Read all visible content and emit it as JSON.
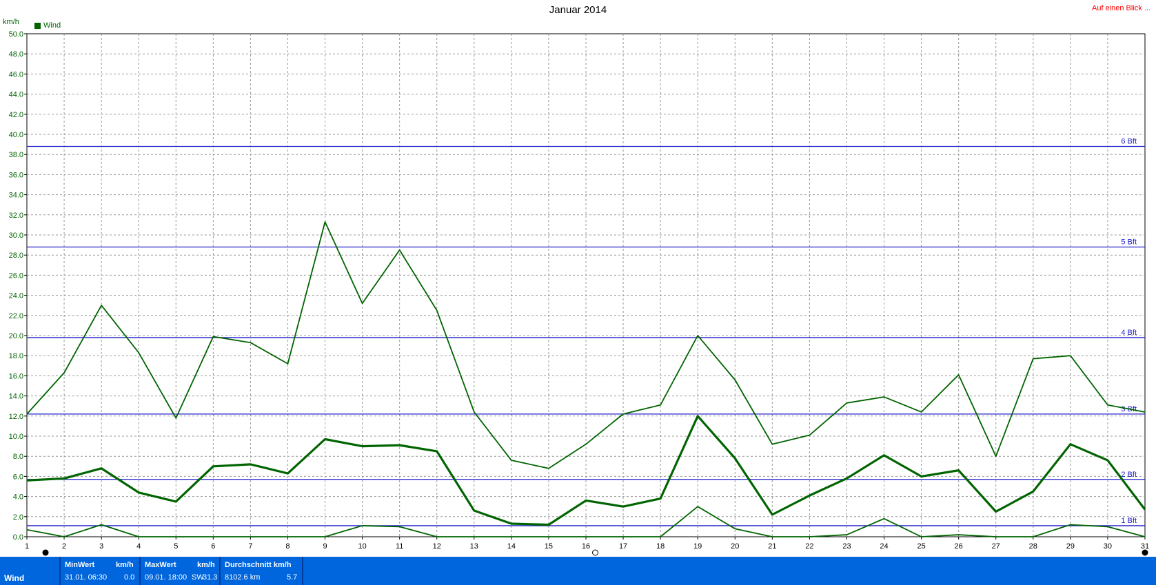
{
  "header": {
    "title": "Januar 2014",
    "link": "Auf einen Blick ...",
    "unit": "km/h",
    "legend_label": "Wind"
  },
  "colors": {
    "series": "#006400",
    "reference": "#2020cc",
    "footer_bg": "#0066dd",
    "link": "#ff0000"
  },
  "chart_data": {
    "type": "line",
    "title": "Januar 2014",
    "ylabel": "km/h",
    "xlim": [
      1,
      31
    ],
    "ylim": [
      0,
      50
    ],
    "ytick_step": 2,
    "grid": true,
    "legend": "top-left",
    "x": [
      1,
      2,
      3,
      4,
      5,
      6,
      7,
      8,
      9,
      10,
      11,
      12,
      13,
      14,
      15,
      16,
      17,
      18,
      19,
      20,
      21,
      22,
      23,
      24,
      25,
      26,
      27,
      28,
      29,
      30,
      31
    ],
    "series": [
      {
        "name": "Wind",
        "role": "max",
        "values": [
          12.2,
          16.3,
          23.0,
          18.3,
          11.8,
          19.9,
          19.3,
          17.2,
          31.3,
          23.2,
          28.5,
          22.5,
          12.4,
          7.6,
          6.8,
          9.2,
          12.2,
          13.1,
          20.0,
          15.6,
          9.2,
          10.1,
          13.3,
          13.9,
          12.4,
          16.1,
          8.0,
          17.7,
          18.0,
          13.1,
          12.4
        ]
      },
      {
        "role": "average",
        "values": [
          5.6,
          5.8,
          6.8,
          4.4,
          3.5,
          7.0,
          7.2,
          6.3,
          9.7,
          9.0,
          9.1,
          8.5,
          2.6,
          1.3,
          1.2,
          3.6,
          3.0,
          3.8,
          12.0,
          7.8,
          2.2,
          4.1,
          5.8,
          8.1,
          6.0,
          6.6,
          2.5,
          4.5,
          9.2,
          7.6,
          2.7
        ]
      },
      {
        "role": "min",
        "values": [
          0.7,
          0.0,
          1.2,
          0.0,
          0.0,
          0.0,
          0.0,
          0.0,
          0.0,
          1.1,
          1.0,
          0.0,
          0.0,
          0.0,
          0.0,
          0.0,
          0.0,
          0.0,
          3.0,
          0.8,
          0.0,
          0.0,
          0.2,
          1.8,
          0.0,
          0.2,
          0.0,
          0.0,
          1.2,
          1.0,
          0.0
        ]
      }
    ],
    "reference_lines": [
      {
        "label": "1 Bft",
        "value": 1.1
      },
      {
        "label": "2 Bft",
        "value": 5.7
      },
      {
        "label": "3 Bft",
        "value": 12.2
      },
      {
        "label": "4 Bft",
        "value": 19.8
      },
      {
        "label": "5 Bft",
        "value": 28.8
      },
      {
        "label": "6 Bft",
        "value": 38.8
      }
    ]
  },
  "footer": {
    "row_label": "Wind",
    "min": {
      "header": "MinWert",
      "unit": "km/h",
      "datetime": "31.01.  06:30",
      "value": "0.0"
    },
    "max": {
      "header": "MaxWert",
      "unit": "km/h",
      "datetime": "09.01.  18:00",
      "direction": "SW",
      "value": "31.3"
    },
    "avg": {
      "header": "Durchschnitt km/h",
      "distance": "8102.6 km",
      "value": "5.7"
    }
  }
}
